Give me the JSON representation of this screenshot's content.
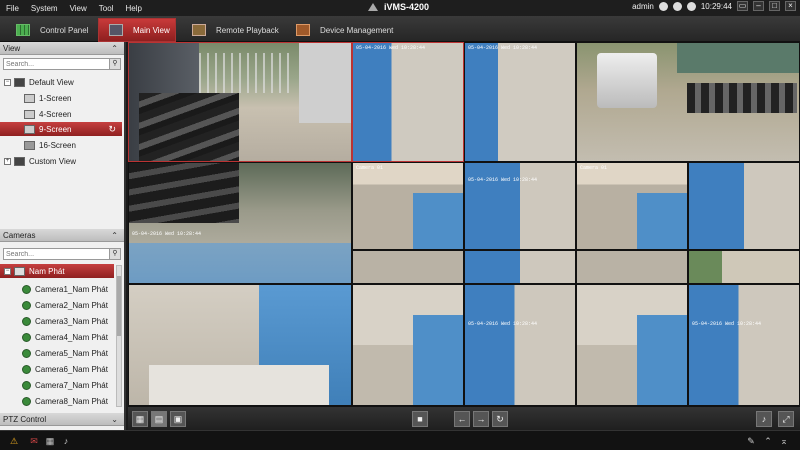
{
  "menu": [
    "File",
    "System",
    "View",
    "Tool",
    "Help"
  ],
  "app_title": "iVMS-4200",
  "user": "admin",
  "clock": "10:29:44",
  "tabs": [
    {
      "label": "Control Panel",
      "icon": "control-panel-icon"
    },
    {
      "label": "Main View",
      "icon": "main-view-icon",
      "active": true
    },
    {
      "label": "Remote Playback",
      "icon": "playback-icon"
    },
    {
      "label": "Device Management",
      "icon": "device-icon"
    }
  ],
  "view_panel": {
    "title": "View",
    "search_placeholder": "Search...",
    "items": [
      {
        "label": "Default View",
        "level": 0
      },
      {
        "label": "1-Screen",
        "level": 1
      },
      {
        "label": "4-Screen",
        "level": 1
      },
      {
        "label": "9-Screen",
        "level": 1,
        "selected": true
      },
      {
        "label": "16-Screen",
        "level": 1
      },
      {
        "label": "Custom View",
        "level": 0
      }
    ]
  },
  "camera_panel": {
    "title": "Cameras",
    "search_placeholder": "Search...",
    "group": "Nam Phát",
    "cameras": [
      "Camera1_Nam Phát",
      "Camera2_Nam Phát",
      "Camera3_Nam Phát",
      "Camera4_Nam Phát",
      "Camera5_Nam Phát",
      "Camera6_Nam Phát",
      "Camera7_Nam Phát",
      "Camera8_Nam Phát"
    ]
  },
  "ptz_panel": {
    "title": "PTZ Control"
  },
  "video_overlays": {
    "timestamp": "05-04-2016 Wed 10:28:44",
    "camera_label": "Camera 01"
  },
  "colors": {
    "accent": "#a82828",
    "wall_blue": "#4f8fc8",
    "concrete": "#c9c3b8"
  }
}
